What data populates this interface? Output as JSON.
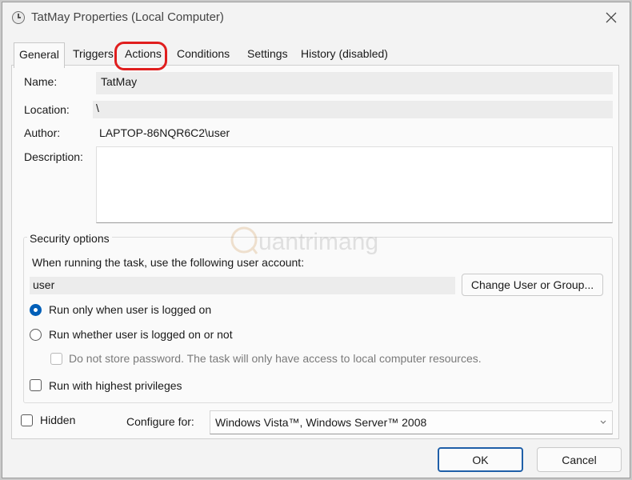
{
  "window": {
    "title": "TatMay Properties (Local Computer)"
  },
  "tabs": [
    {
      "label": "General"
    },
    {
      "label": "Triggers"
    },
    {
      "label": "Actions"
    },
    {
      "label": "Conditions"
    },
    {
      "label": "Settings"
    },
    {
      "label": "History (disabled)"
    }
  ],
  "general": {
    "name_label": "Name:",
    "name_value": "TatMay",
    "location_label": "Location:",
    "location_value": "\\",
    "author_label": "Author:",
    "author_value": "LAPTOP-86NQR6C2\\user",
    "description_label": "Description:",
    "description_value": ""
  },
  "security": {
    "legend": "Security options",
    "account_prompt": "When running the task, use the following user account:",
    "account_value": "user",
    "change_button": "Change User or Group...",
    "radio_logged_on": "Run only when user is logged on",
    "radio_logged_on_checked": true,
    "radio_whether": "Run whether user is logged on or not",
    "radio_whether_checked": false,
    "no_store_password": "Do not store password.  The task will only have access to local computer resources.",
    "no_store_password_checked": false,
    "highest_privileges": "Run with highest privileges",
    "highest_privileges_checked": false
  },
  "footer": {
    "hidden_label": "Hidden",
    "hidden_checked": false,
    "configure_label": "Configure for:",
    "configure_value": "Windows Vista™, Windows Server™ 2008"
  },
  "buttons": {
    "ok": "OK",
    "cancel": "Cancel"
  },
  "watermark": {
    "text": "uantrimang"
  },
  "colors": {
    "accent": "#005fb8",
    "highlight_ring": "#e01e1e",
    "background": "#f3f3f3"
  },
  "icons": {
    "title": "clock-icon",
    "close": "close-icon",
    "dropdown": "chevron-down-icon"
  }
}
